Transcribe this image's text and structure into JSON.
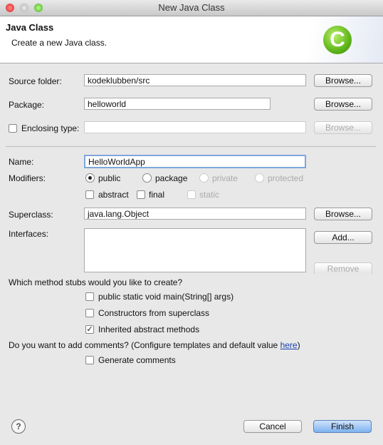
{
  "window": {
    "title": "New Java Class"
  },
  "header": {
    "title": "Java Class",
    "subtitle": "Create a new Java class.",
    "icon": "java-class-c-icon",
    "icon_color": "#6cbf1e"
  },
  "fields": {
    "source_folder": {
      "label": "Source folder:",
      "value": "kodeklubben/src",
      "button": "Browse..."
    },
    "package": {
      "label": "Package:",
      "value": "helloworld",
      "button": "Browse..."
    },
    "enclosing_type": {
      "label": "Enclosing type:",
      "value": "",
      "button": "Browse...",
      "checked": false
    },
    "name": {
      "label": "Name:",
      "value": "HelloWorldApp"
    },
    "modifiers": {
      "label": "Modifiers:",
      "radios": [
        {
          "label": "public",
          "selected": true
        },
        {
          "label": "package",
          "selected": false
        },
        {
          "label": "private",
          "disabled": true
        },
        {
          "label": "protected",
          "disabled": true
        }
      ],
      "checks": [
        {
          "label": "abstract",
          "checked": false
        },
        {
          "label": "final",
          "checked": false
        },
        {
          "label": "static",
          "disabled": true
        }
      ]
    },
    "superclass": {
      "label": "Superclass:",
      "value": "java.lang.Object",
      "button": "Browse..."
    },
    "interfaces": {
      "label": "Interfaces:",
      "add": "Add...",
      "remove": "Remove"
    }
  },
  "stubs": {
    "question": "Which method stubs would you like to create?",
    "options": [
      {
        "label": "public static void main(String[] args)",
        "checked": false
      },
      {
        "label": "Constructors from superclass",
        "checked": false
      },
      {
        "label": "Inherited abstract methods",
        "checked": true
      }
    ]
  },
  "comments": {
    "question": "Do you want to add comments? (Configure templates and default value ",
    "link": "here",
    "close": ")",
    "option": "Generate comments",
    "checked": false
  },
  "footer": {
    "cancel": "Cancel",
    "finish": "Finish",
    "help": "?"
  }
}
